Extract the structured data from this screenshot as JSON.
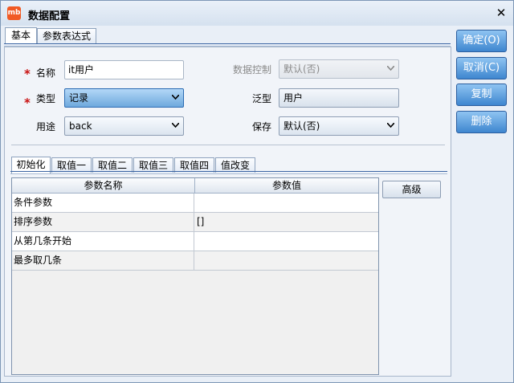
{
  "window": {
    "title": "数据配置",
    "close_glyph": "✕",
    "app_icon_text": "mb"
  },
  "top_tabs": [
    {
      "label": "基本"
    },
    {
      "label": "参数表达式"
    }
  ],
  "form": {
    "name_label": "名称",
    "name_value": "it用户",
    "type_label": "类型",
    "type_value": "记录",
    "usage_label": "用途",
    "usage_value": "back",
    "data_control_label": "数据控制",
    "data_control_value": "默认(否)",
    "generic_label": "泛型",
    "generic_value": "用户",
    "save_label": "保存",
    "save_value": "默认(否)",
    "required_mark": "*"
  },
  "inner_tabs": [
    {
      "label": "初始化"
    },
    {
      "label": "取值一"
    },
    {
      "label": "取值二"
    },
    {
      "label": "取值三"
    },
    {
      "label": "取值四"
    },
    {
      "label": "值改变"
    }
  ],
  "table": {
    "columns": [
      "参数名称",
      "参数值"
    ],
    "rows": [
      {
        "name": "条件参数",
        "value": ""
      },
      {
        "name": "排序参数",
        "value": "[]"
      },
      {
        "name": "从第几条开始",
        "value": ""
      },
      {
        "name": "最多取几条",
        "value": ""
      }
    ]
  },
  "advanced_button": "高级",
  "side_buttons": {
    "ok": "确定(O)",
    "cancel": "取消(C)",
    "copy": "复制",
    "delete": "删除"
  },
  "colors": {
    "accent": "#3e86cf",
    "required": "#c91111",
    "app_icon": "#f15a24"
  }
}
